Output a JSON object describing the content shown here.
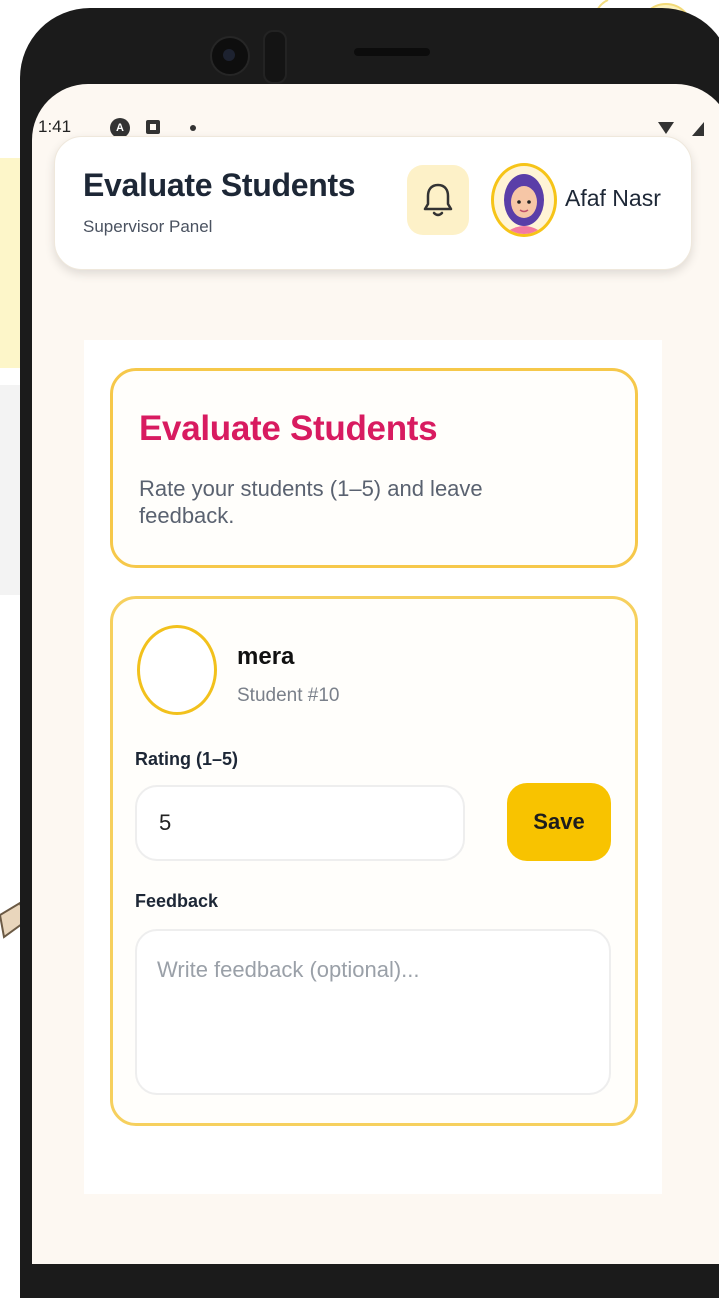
{
  "status_bar": {
    "time": "1:41"
  },
  "header": {
    "title": "Evaluate Students",
    "subtitle": "Supervisor Panel",
    "user_name": "Afaf Nasr"
  },
  "intro": {
    "title": "Evaluate Students",
    "description": "Rate your students (1–5) and leave feedback."
  },
  "student": {
    "name": "mera",
    "id_label": "Student #10",
    "rating_label": "Rating (1–5)",
    "rating_value": "5",
    "save_label": "Save",
    "feedback_label": "Feedback",
    "feedback_placeholder": "Write feedback (optional)..."
  },
  "icons": {
    "notifications": "bell-icon",
    "avatar": "user-avatar-icon"
  },
  "colors": {
    "accent_yellow": "#f8c300",
    "title_pink": "#d81b60",
    "card_border": "#f6c84a"
  }
}
